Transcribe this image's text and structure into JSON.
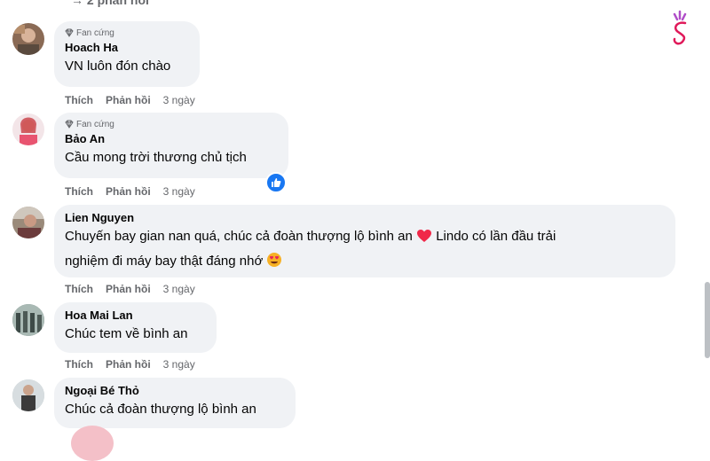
{
  "thread": {
    "replies_link": "→ 2 phản hồi"
  },
  "actions": {
    "like": "Thích",
    "reply": "Phản hồi"
  },
  "comments": [
    {
      "badge": "Fan cứng",
      "author": "Hoach Ha",
      "text": "VN luôn đón chào",
      "time": "3 ngày"
    },
    {
      "badge": "Fan cứng",
      "author": "Bảo An",
      "text": "Cầu mong trời thương chủ tịch",
      "time": "3 ngày",
      "reaction": "like-icon"
    },
    {
      "author": "Lien Nguyen",
      "text_line1": "Chuyến bay gian nan quá, chúc cả đoàn thượng lộ bình an",
      "text_line1b": "Lindo có lần đầu trải",
      "text_line2": "nghiệm đi máy bay thật đáng nhớ",
      "time": "3 ngày",
      "emojis": [
        "heart-emoji",
        "heart-eyes-emoji"
      ]
    },
    {
      "author": "Hoa Mai Lan",
      "text": "Chúc tem về bình an",
      "time": "3 ngày"
    },
    {
      "author": "Ngoại Bé Thỏ",
      "text": "Chúc cả đoàn thượng lộ bình an"
    }
  ],
  "colors": {
    "bubble": "#f0f2f5",
    "meta_text": "#65676b",
    "like_blue": "#1877f2",
    "heart_red": "#f02849",
    "brand_pink": "#e0195a"
  }
}
